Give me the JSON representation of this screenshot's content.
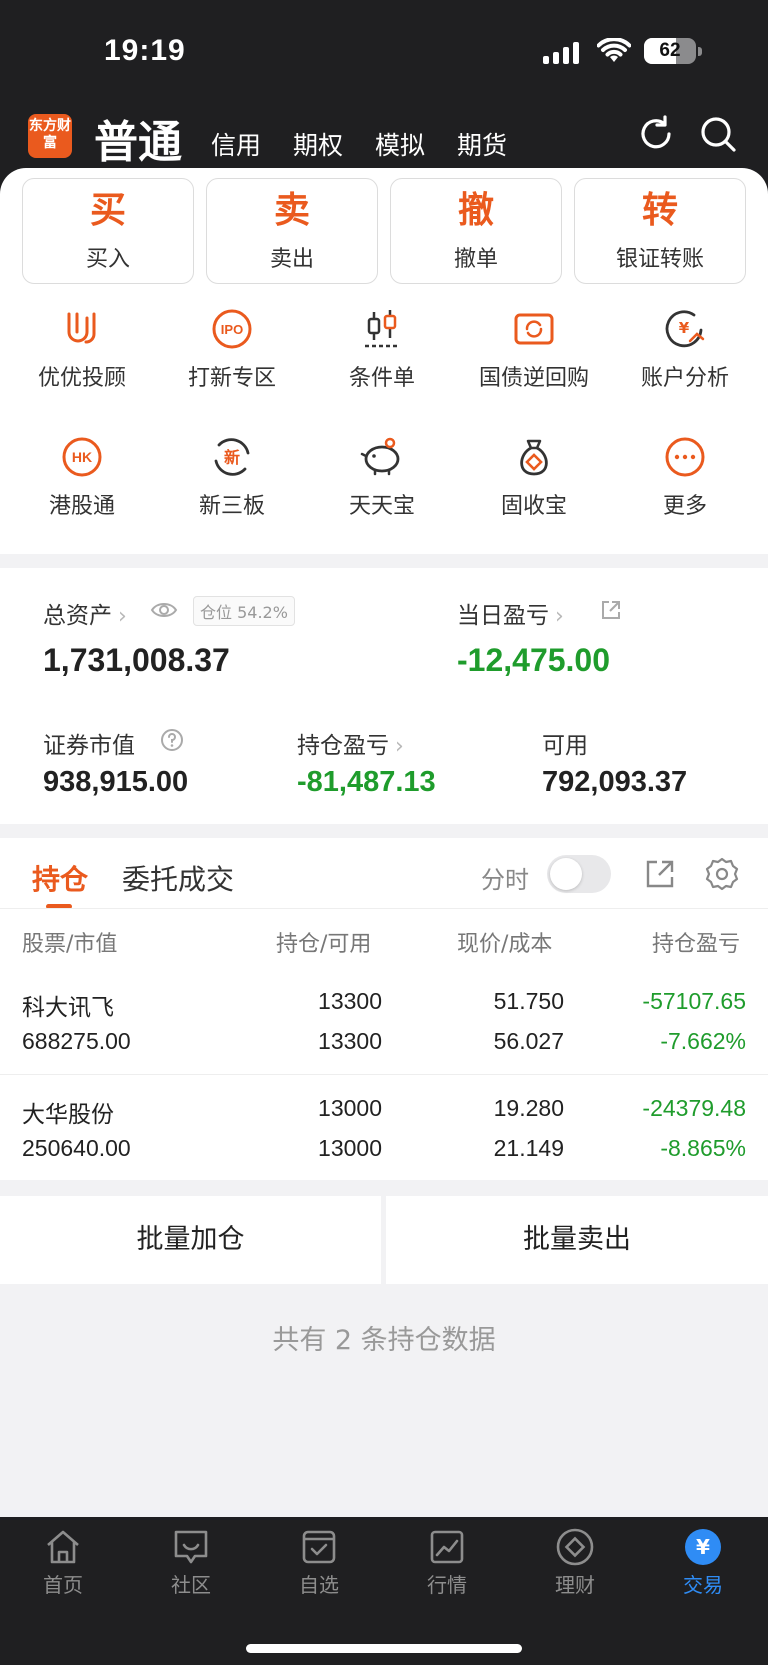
{
  "status_bar": {
    "time": "19:19",
    "battery": "62",
    "battery_fraction": 0.62
  },
  "header": {
    "logo_text": "东方财富",
    "active_tab": "普通",
    "tabs": [
      "信用",
      "期权",
      "模拟",
      "期货"
    ],
    "icons": [
      "refresh-icon",
      "search-icon"
    ]
  },
  "actions": [
    {
      "big": "买",
      "small": "买入"
    },
    {
      "big": "卖",
      "small": "卖出"
    },
    {
      "big": "撤",
      "small": "撤单"
    },
    {
      "big": "转",
      "small": "银证转账"
    }
  ],
  "services": [
    {
      "label": "优优投顾",
      "icon": "u-logo-icon"
    },
    {
      "label": "打新专区",
      "icon": "ipo-icon"
    },
    {
      "label": "条件单",
      "icon": "candlestick-icon"
    },
    {
      "label": "国债逆回购",
      "icon": "bond-repo-icon"
    },
    {
      "label": "账户分析",
      "icon": "yuan-chart-icon"
    },
    {
      "label": "港股通",
      "icon": "hk-icon",
      "badge": "HK"
    },
    {
      "label": "新三板",
      "icon": "new-board-icon",
      "badge": "新"
    },
    {
      "label": "天天宝",
      "icon": "piggy-bank-icon"
    },
    {
      "label": "固收宝",
      "icon": "money-bag-icon"
    },
    {
      "label": "更多",
      "icon": "more-icon"
    }
  ],
  "assets": {
    "total_label": "总资产",
    "total_value": "1,731,008.37",
    "position_badge": "仓位 54.2%",
    "daily_pl_label": "当日盈亏",
    "daily_pl_value": "-12,475.00",
    "market_value_label": "证券市值",
    "market_value": "938,915.00",
    "holding_pl_label": "持仓盈亏",
    "holding_pl_value": "-81,487.13",
    "available_label": "可用",
    "available_value": "792,093.37"
  },
  "holdings": {
    "tabs": [
      "持仓",
      "委托成交"
    ],
    "fenshi_label": "分时",
    "columns": [
      "股票/市值",
      "持仓/可用",
      "现价/成本",
      "持仓盈亏"
    ],
    "rows": [
      {
        "name": "科大讯飞",
        "market_value": "688275.00",
        "position": "13300",
        "available": "13300",
        "price": "51.750",
        "cost": "56.027",
        "pl": "-57107.65",
        "pl_pct": "-7.662%"
      },
      {
        "name": "大华股份",
        "market_value": "250640.00",
        "position": "13000",
        "available": "13000",
        "price": "19.280",
        "cost": "21.149",
        "pl": "-24379.48",
        "pl_pct": "-8.865%"
      }
    ]
  },
  "batch": {
    "add": "批量加仓",
    "sell": "批量卖出"
  },
  "summary": "共有 2 条持仓数据",
  "bottom_nav": [
    {
      "label": "首页",
      "icon": "home-icon"
    },
    {
      "label": "社区",
      "icon": "community-icon"
    },
    {
      "label": "自选",
      "icon": "watchlist-icon"
    },
    {
      "label": "行情",
      "icon": "market-icon"
    },
    {
      "label": "理财",
      "icon": "wealth-icon"
    },
    {
      "label": "交易",
      "icon": "trade-icon",
      "glyph": "¥"
    }
  ],
  "colors": {
    "accent": "#ea5a1e",
    "loss": "#1f9c2c",
    "active_nav": "#2f8cf5",
    "header_bg": "#1f1f21"
  }
}
